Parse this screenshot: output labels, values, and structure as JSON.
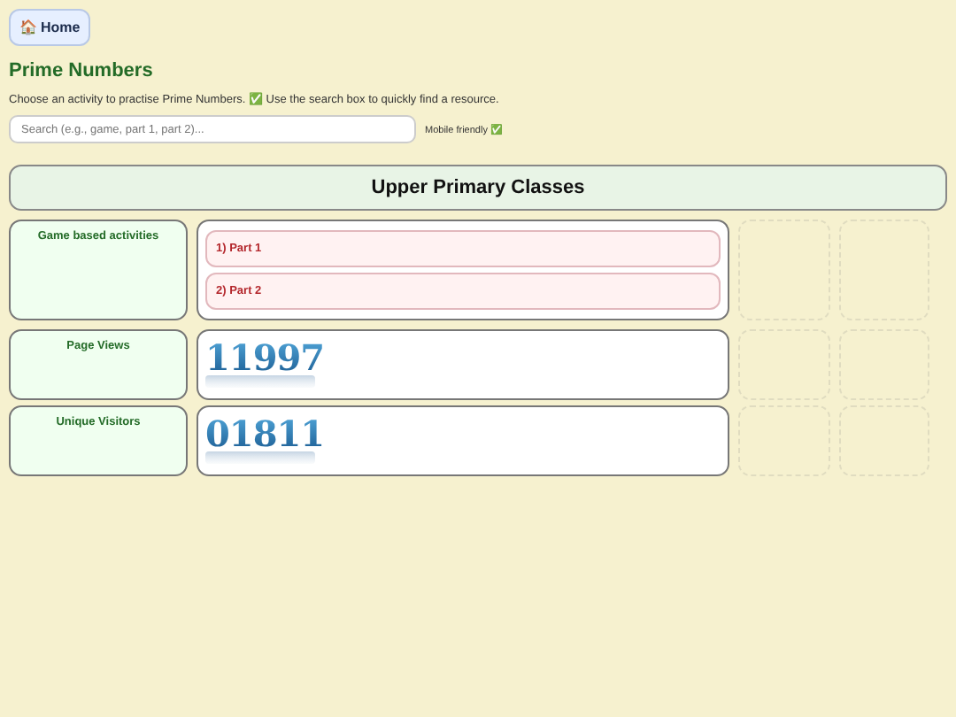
{
  "home_button": {
    "icon": "🏠",
    "label": "Home"
  },
  "title": "Prime Numbers",
  "intro": "Choose an activity to practise Prime Numbers. ✅ Use the search box to quickly find a resource.",
  "search": {
    "placeholder": "Search (e.g., game, part 1, part 2)..."
  },
  "mobile_note": "Mobile friendly ✅",
  "section": {
    "title": "Upper Primary Classes"
  },
  "rows": [
    {
      "label": "Game based activities",
      "kind": "links",
      "links": [
        "1) Part 1",
        "2) Part 2"
      ]
    },
    {
      "label": "Page Views",
      "kind": "counter",
      "value": "11997"
    },
    {
      "label": "Unique Visitors",
      "kind": "counter",
      "value": "01811"
    }
  ]
}
